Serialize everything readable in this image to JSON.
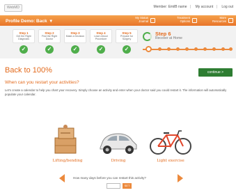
{
  "header": {
    "logo": "WebMD",
    "links": [
      "Member: EmilB name",
      "My account",
      "Log out"
    ]
  },
  "menubar": {
    "title": "Profile Demo: Back",
    "buttons": [
      {
        "label_1": "My Status",
        "label_2": "Journal"
      },
      {
        "label_1": "Treatment",
        "label_2": "Options"
      },
      {
        "label_1": "More",
        "label_2": "Resources"
      }
    ]
  },
  "steps": [
    {
      "num": "Step 1",
      "label": "Get the Right Diagnosis"
    },
    {
      "num": "Step 2",
      "label": "Find the Right Doctor"
    },
    {
      "num": "Step 3",
      "label": "Make a Decision"
    },
    {
      "num": "Step 4",
      "label": "Learn About Procedure"
    },
    {
      "num": "Step 5",
      "label": "Prepare for Surgery"
    }
  ],
  "current_step": {
    "num": "Step 6",
    "label": "Recover at Home"
  },
  "main": {
    "title": "Back to 100%",
    "continue_label": "continue >",
    "subhead": "When can you restart your activities?",
    "body": "Let's create a calendar to help you chart your recovery. Simply choose an activity and enter when your doctor said you could restart it. The information will automatically populate your calendar."
  },
  "activities": [
    {
      "label": "Lifting/bending",
      "icon": "boxes-icon"
    },
    {
      "label": "Driving",
      "icon": "car-icon"
    },
    {
      "label": "Light exercise",
      "icon": "bicycle-icon"
    }
  ],
  "question": {
    "text": "How many days before you can restart this activity?",
    "input_value": "",
    "set_label": "SET"
  },
  "colors": {
    "accent": "#e36a1c",
    "check": "#4fae4b",
    "continue": "#2e7d32"
  }
}
